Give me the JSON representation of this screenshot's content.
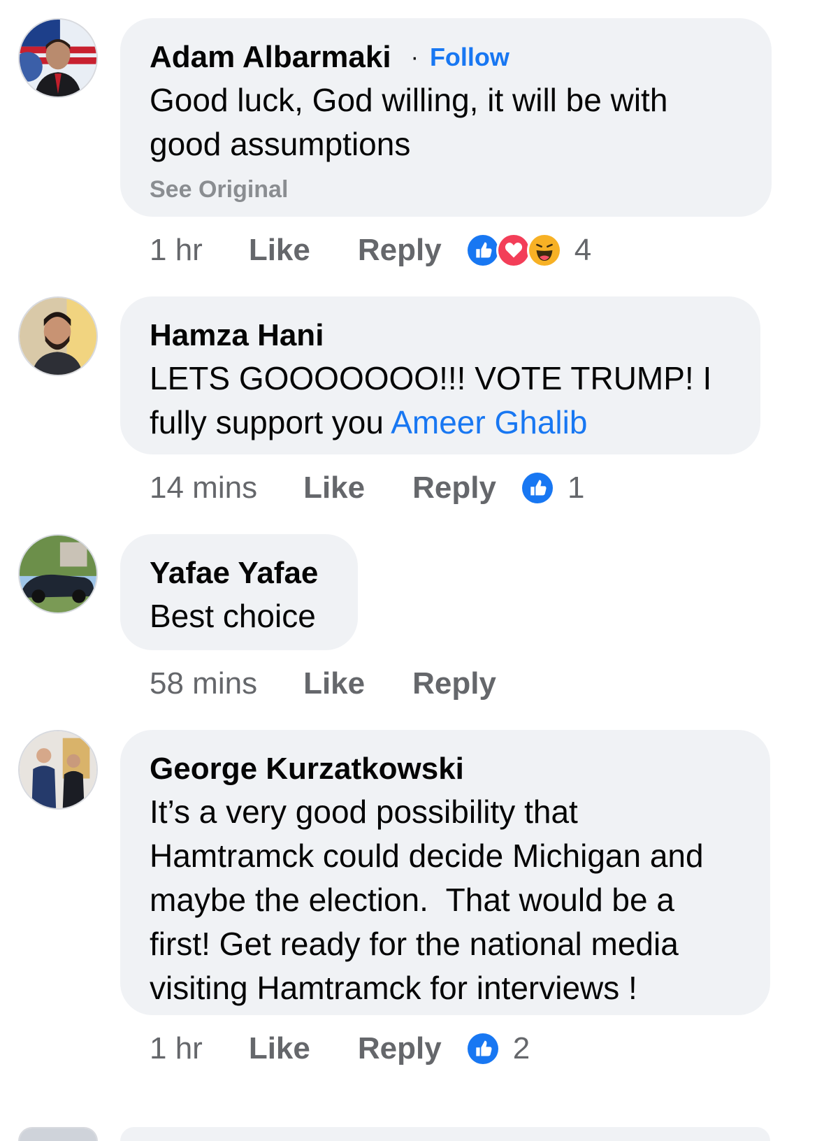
{
  "comments": [
    {
      "author": "Adam Albarmaki",
      "follow_label": "Follow",
      "text": "Good luck, God willing, it will be with good assumptions",
      "see_original": "See Original",
      "time": "1 hr",
      "like_label": "Like",
      "reply_label": "Reply",
      "reactions": [
        "like-icon",
        "love-icon",
        "haha-icon"
      ],
      "reaction_count": "4"
    },
    {
      "author": "Hamza Hani",
      "text_before_mention": "LETS GOOOOOOO!!! VOTE TRUMP! I fully support you ",
      "mention": "Ameer Ghalib",
      "time": "14 mins",
      "like_label": "Like",
      "reply_label": "Reply",
      "reactions": [
        "like-icon"
      ],
      "reaction_count": "1"
    },
    {
      "author": "Yafae Yafae",
      "text": "Best choice",
      "time": "58 mins",
      "like_label": "Like",
      "reply_label": "Reply"
    },
    {
      "author": "George Kurzatkowski",
      "text": "It’s a very good possibility that Hamtramck could decide Michigan and maybe the election.  That would be a first! Get ready for the national media visiting Hamtramck for interviews !",
      "time": "1 hr",
      "like_label": "Like",
      "reply_label": "Reply",
      "reactions": [
        "like-icon"
      ],
      "reaction_count": "2"
    }
  ],
  "colors": {
    "bubble": "#f0f2f5",
    "link_blue": "#1877f2",
    "meta_gray": "#65676b",
    "see_original_gray": "#8a8d91",
    "love_red": "#f33e58",
    "haha_yellow": "#f7b125"
  }
}
